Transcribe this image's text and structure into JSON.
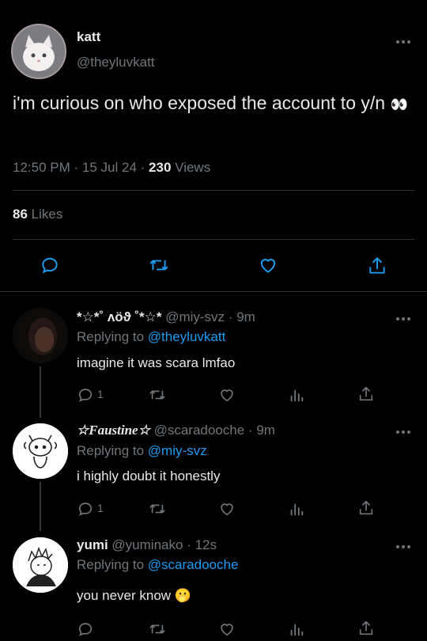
{
  "main_tweet": {
    "display_name": "katt",
    "handle": "@theyluvkatt",
    "text": "i'm curious on who exposed the account to y/n",
    "emoji": "👀",
    "time": "12:50 PM",
    "date": "15 Jul 24",
    "views_count": "230",
    "views_label": "Views",
    "likes_count": "86",
    "likes_label": "Likes"
  },
  "replies": [
    {
      "display_name": "*☆*˚ ʌöϑ ˚*☆*",
      "handle": "@miy-svz",
      "time": "9m",
      "replying_prefix": "Replying to",
      "replying_to": "@theyluvkatt",
      "text": "imagine it was scara lmfao",
      "reply_count": "1"
    },
    {
      "display_name": "☆Faustine☆",
      "handle": "@scaradooche",
      "time": "9m",
      "replying_prefix": "Replying to",
      "replying_to": "@miy-svz",
      "text": "i highly doubt it honestly",
      "reply_count": "1"
    },
    {
      "display_name": "yumi",
      "handle": "@yuminako",
      "time": "12s",
      "replying_prefix": "Replying to",
      "replying_to": "@scaradooche",
      "text": "you never know",
      "emoji": "🫢"
    }
  ],
  "separator": "·",
  "colors": {
    "background": "#000000",
    "text": "#e7e9ea",
    "secondary": "#71767b",
    "accent": "#1d9bf0",
    "divider": "#2f3336"
  },
  "icons": [
    "more-icon",
    "reply-icon",
    "retweet-icon",
    "like-icon",
    "share-icon",
    "analytics-icon",
    "eyes-emoji",
    "hand-over-mouth-emoji"
  ]
}
